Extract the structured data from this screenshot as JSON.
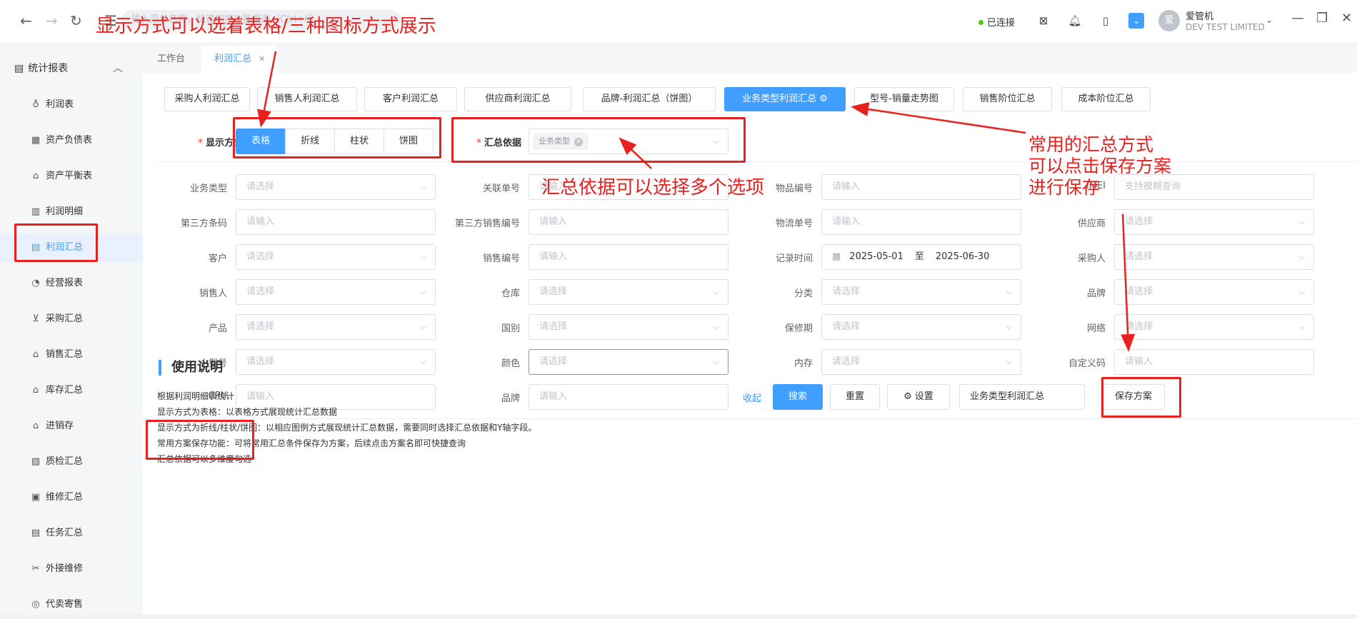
{
  "topbar": {
    "address_placeholder": "输入菜单名称，快速切换功能页面（Ctrl+K）",
    "connection_status": "已连接",
    "user_avatar_text": "爱",
    "user_name": "爱管机",
    "company": "DEV TEST LIMITED"
  },
  "sidebar": {
    "section": "统计报表",
    "items": [
      {
        "label": "利润表",
        "icon": "money-bag-icon"
      },
      {
        "label": "资产负债表",
        "icon": "ledger-icon"
      },
      {
        "label": "资产平衡表",
        "icon": "balance-icon"
      },
      {
        "label": "利润明细",
        "icon": "chart-bars-icon"
      },
      {
        "label": "利润汇总",
        "icon": "report-icon",
        "active": true
      },
      {
        "label": "经营报表",
        "icon": "trend-icon"
      },
      {
        "label": "采购汇总",
        "icon": "cart-icon"
      },
      {
        "label": "销售汇总",
        "icon": "shop-icon"
      },
      {
        "label": "库存汇总",
        "icon": "warehouse-icon"
      },
      {
        "label": "进销存",
        "icon": "home-icon"
      },
      {
        "label": "质检汇总",
        "icon": "inspect-icon"
      },
      {
        "label": "维修汇总",
        "icon": "repair-icon"
      },
      {
        "label": "任务汇总",
        "icon": "task-icon"
      },
      {
        "label": "外接维修",
        "icon": "tools-icon"
      },
      {
        "label": "代卖寄售",
        "icon": "consign-icon"
      }
    ]
  },
  "tabs": [
    {
      "label": "工作台"
    },
    {
      "label": "利润汇总",
      "closable": true,
      "active": true
    }
  ],
  "report_tabs": [
    "采购人利润汇总",
    "销售人利润汇总",
    "客户利润汇总",
    "供应商利润汇总",
    "品牌-利润汇总（饼图）",
    "业务类型利润汇总",
    "型号-销量走势图",
    "销售阶位汇总",
    "成本阶位汇总"
  ],
  "display": {
    "label": "显示方式",
    "options": [
      "表格",
      "折线",
      "柱状",
      "饼图"
    ],
    "selected": "表格"
  },
  "group_by": {
    "label": "汇总依据",
    "tag": "业务类型"
  },
  "filters": {
    "row1": [
      {
        "label": "业务类型",
        "placeholder": "请选择",
        "type": "select"
      },
      {
        "label": "关联单号",
        "placeholder": "请输入",
        "type": "input"
      },
      {
        "label": "物品编号",
        "placeholder": "请输入",
        "type": "input"
      },
      {
        "label": "IMEI",
        "placeholder": "支持模糊查询",
        "type": "input"
      }
    ],
    "row2": [
      {
        "label": "第三方条码",
        "placeholder": "请输入",
        "type": "input"
      },
      {
        "label": "第三方销售编号",
        "placeholder": "请输入",
        "type": "input"
      },
      {
        "label": "物流单号",
        "placeholder": "请输入",
        "type": "input"
      },
      {
        "label": "供应商",
        "placeholder": "请选择",
        "type": "select"
      }
    ],
    "row3": [
      {
        "label": "客户",
        "placeholder": "请选择",
        "type": "select"
      },
      {
        "label": "销售编号",
        "placeholder": "请输入",
        "type": "input"
      },
      {
        "label": "记录时间",
        "date_from": "2025-05-01",
        "date_sep": "至",
        "date_to": "2025-06-30",
        "type": "date"
      },
      {
        "label": "采购人",
        "placeholder": "请选择",
        "type": "select"
      }
    ],
    "row4": [
      {
        "label": "销售人",
        "placeholder": "请选择",
        "type": "select"
      },
      {
        "label": "仓库",
        "placeholder": "请选择",
        "type": "select"
      },
      {
        "label": "分类",
        "placeholder": "请选择",
        "type": "select"
      },
      {
        "label": "品牌",
        "placeholder": "请选择",
        "type": "select"
      }
    ],
    "row5": [
      {
        "label": "产品",
        "placeholder": "请选择",
        "type": "select"
      },
      {
        "label": "国别",
        "placeholder": "请选择",
        "type": "select"
      },
      {
        "label": "保修期",
        "placeholder": "请选择",
        "type": "select"
      },
      {
        "label": "网络",
        "placeholder": "请选择",
        "type": "select"
      }
    ],
    "row6": [
      {
        "label": "小型号",
        "placeholder": "请选择",
        "type": "select"
      },
      {
        "label": "颜色",
        "placeholder": "请选择",
        "type": "select"
      },
      {
        "label": "内存",
        "placeholder": "请选择",
        "type": "select"
      },
      {
        "label": "自定义码",
        "placeholder": "请输入",
        "type": "input"
      }
    ],
    "row7": [
      {
        "label": "CPU",
        "placeholder": "请输入",
        "type": "input"
      },
      {
        "label": "品牌",
        "placeholder": "请输入",
        "type": "input"
      }
    ]
  },
  "actions": {
    "collapse": "收起",
    "search": "搜索",
    "reset": "重置",
    "settings": "设置",
    "plan_name": "业务类型利润汇总",
    "save_plan": "保存方案"
  },
  "usage": {
    "title": "使用说明",
    "lines": [
      "根据利润明细表统计",
      "显示方式为表格：以表格方式展现统计汇总数据",
      "显示方式为折线/柱状/饼图：以相应图例方式展现统计汇总数据，需要同时选择汇总依据和Y轴字段。",
      "常用方案保存功能：可将常用汇总条件保存为方案，后续点击方案名即可快捷查询",
      "汇总依据可以多维度勾选"
    ]
  },
  "annotations": {
    "display_note": "显示方式可以选着表格/三种图标方式展示",
    "groupby_note": "汇总依据可以选择多个选项",
    "save_note_1": "常用的汇总方式",
    "save_note_2": "可以点击保存方案",
    "save_note_3": "进行保存",
    "color": "#e8201e"
  },
  "colors": {
    "accent": "#409eff",
    "required": "#f56c6c",
    "online": "#52c41a"
  }
}
